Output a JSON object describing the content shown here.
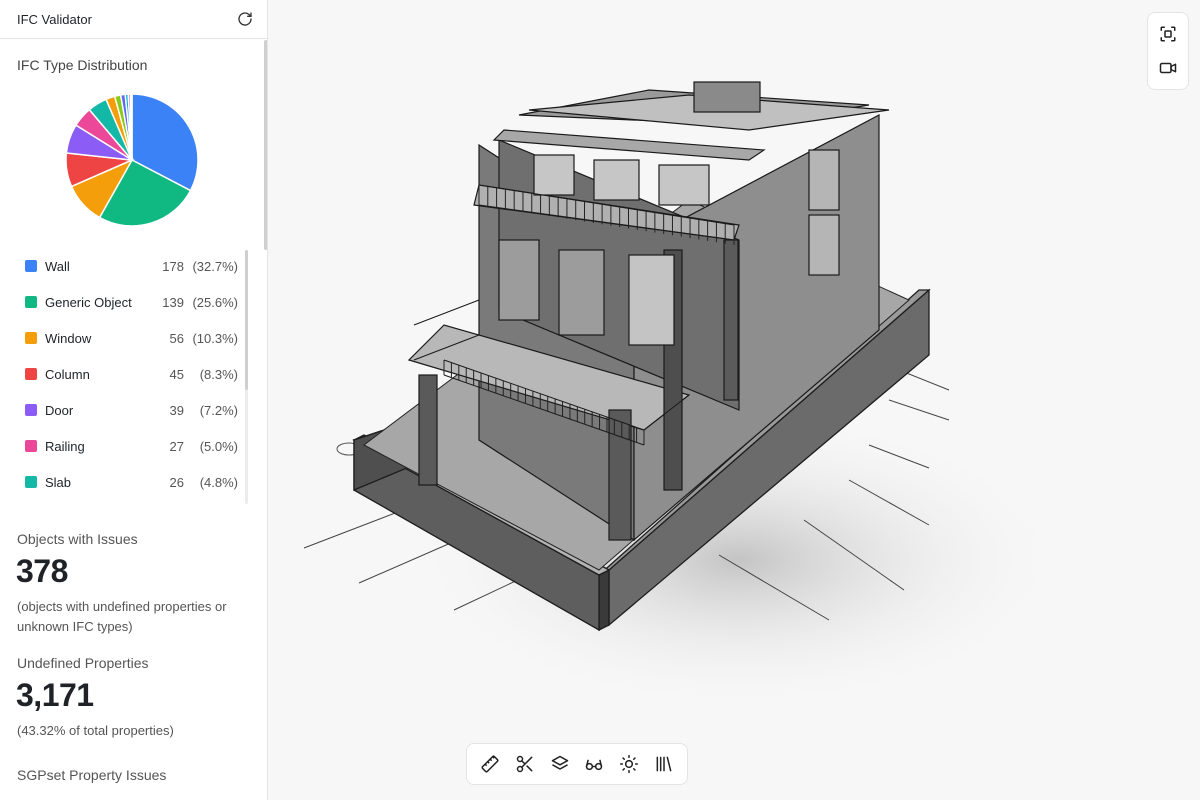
{
  "app": {
    "title": "IFC Validator"
  },
  "distribution": {
    "title": "IFC Type Distribution",
    "items": [
      {
        "label": "Wall",
        "count": "178",
        "pct": "(32.7%)",
        "value": 178,
        "color": "#3b82f6"
      },
      {
        "label": "Generic Object",
        "count": "139",
        "pct": "(25.6%)",
        "value": 139,
        "color": "#10b981"
      },
      {
        "label": "Window",
        "count": "56",
        "pct": "(10.3%)",
        "value": 56,
        "color": "#f59e0b"
      },
      {
        "label": "Column",
        "count": "45",
        "pct": "(8.3%)",
        "value": 45,
        "color": "#ef4444"
      },
      {
        "label": "Door",
        "count": "39",
        "pct": "(7.2%)",
        "value": 39,
        "color": "#8b5cf6"
      },
      {
        "label": "Railing",
        "count": "27",
        "pct": "(5.0%)",
        "value": 27,
        "color": "#ec4899"
      },
      {
        "label": "Slab",
        "count": "26",
        "pct": "(4.8%)",
        "value": 26,
        "color": "#14b8a6"
      }
    ],
    "extra_slices": [
      {
        "value": 12,
        "color": "#f59e0b"
      },
      {
        "value": 8,
        "color": "#84cc16"
      },
      {
        "value": 6,
        "color": "#6366f1"
      },
      {
        "value": 4,
        "color": "#06b6d4"
      },
      {
        "value": 3,
        "color": "#a855f7"
      },
      {
        "value": 2,
        "color": "#94a3b8"
      }
    ]
  },
  "issues": {
    "label": "Objects with Issues",
    "value": "378",
    "note": "(objects with undefined properties or unknown IFC types)"
  },
  "undefined": {
    "label": "Undefined Properties",
    "value": "3,171",
    "note": "(43.32% of total properties)"
  },
  "sgpset": {
    "label": "SGPset Property Issues"
  },
  "icons": {
    "refresh": "refresh-icon",
    "fit": "fit-view-icon",
    "camera": "video-camera-icon",
    "toolbar": [
      "ruler-icon",
      "scissors-icon",
      "layers-icon",
      "glasses-icon",
      "sun-icon",
      "library-icon"
    ]
  }
}
